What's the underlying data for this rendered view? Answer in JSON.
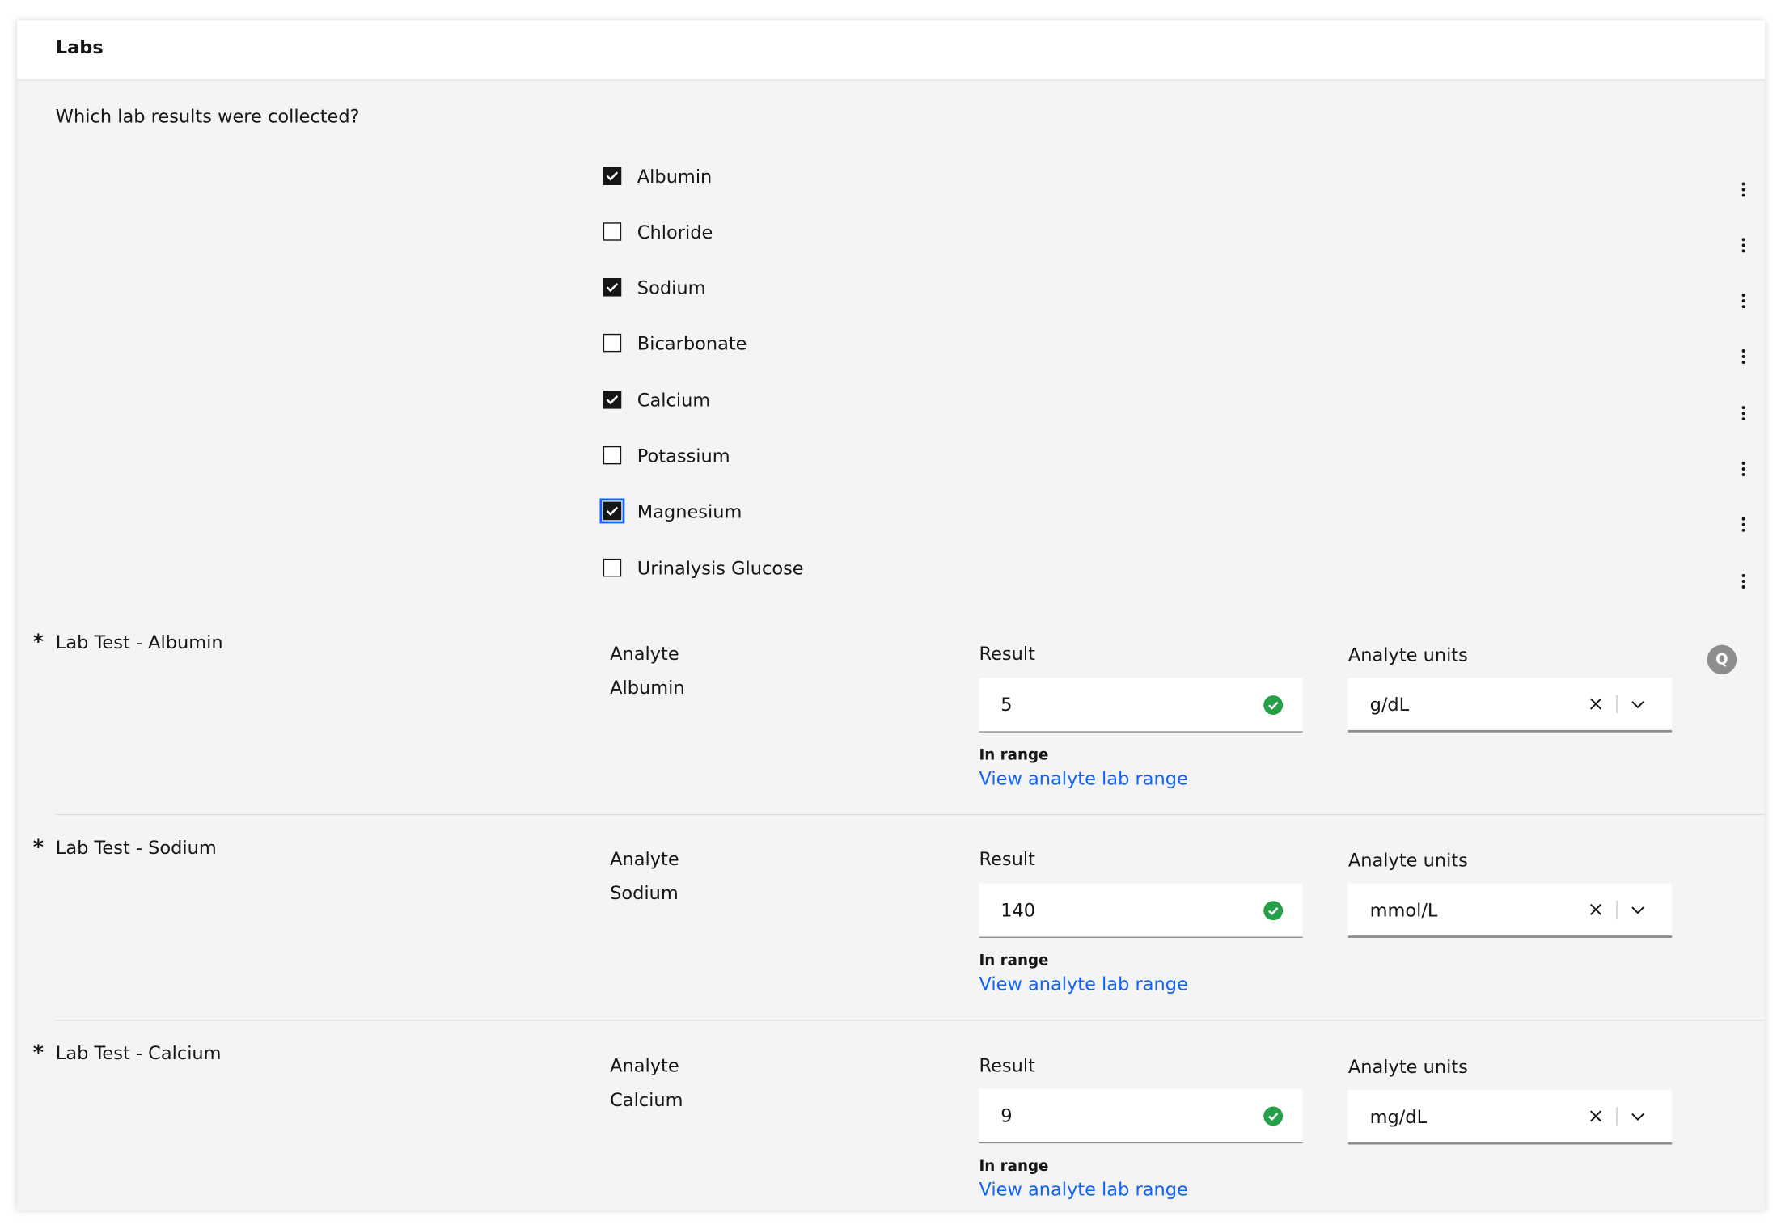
{
  "panel": {
    "title": "Labs"
  },
  "question": "Which lab results were collected?",
  "checkboxes": [
    {
      "label": "Albumin",
      "checked": true
    },
    {
      "label": "Chloride",
      "checked": false
    },
    {
      "label": "Sodium",
      "checked": true
    },
    {
      "label": "Bicarbonate",
      "checked": false
    },
    {
      "label": "Calcium",
      "checked": true
    },
    {
      "label": "Potassium",
      "checked": false
    },
    {
      "label": "Magnesium",
      "checked": true,
      "focused": true
    },
    {
      "label": "Urinalysis Glucose",
      "checked": false
    }
  ],
  "lab_tests": [
    {
      "required_mark": "*",
      "title": "Lab Test - Albumin",
      "analyte_label": "Analyte",
      "analyte_value": "Albumin",
      "result_label": "Result",
      "result_value": "5",
      "status": "In range",
      "range_link": "View analyte lab range",
      "units_label": "Analyte units",
      "units_value": "g/dL"
    },
    {
      "required_mark": "*",
      "title": "Lab Test - Sodium",
      "analyte_label": "Analyte",
      "analyte_value": "Sodium",
      "result_label": "Result",
      "result_value": "140",
      "status": "In range",
      "range_link": "View analyte lab range",
      "units_label": "Analyte units",
      "units_value": "mmol/L"
    },
    {
      "required_mark": "*",
      "title": "Lab Test - Calcium",
      "analyte_label": "Analyte",
      "analyte_value": "Calcium",
      "result_label": "Result",
      "result_value": "9",
      "status": "In range",
      "range_link": "View analyte lab range",
      "units_label": "Analyte units",
      "units_value": "mg/dL"
    }
  ],
  "query_badge": "Q",
  "colors": {
    "accent_link": "#0f62fe",
    "success": "#24a148",
    "background": "#f4f4f4"
  },
  "icons": {
    "overflow": "overflow-menu-vertical-icon",
    "valid": "checkmark-filled-icon",
    "clear": "close-icon",
    "dropdown": "chevron-down-icon"
  }
}
